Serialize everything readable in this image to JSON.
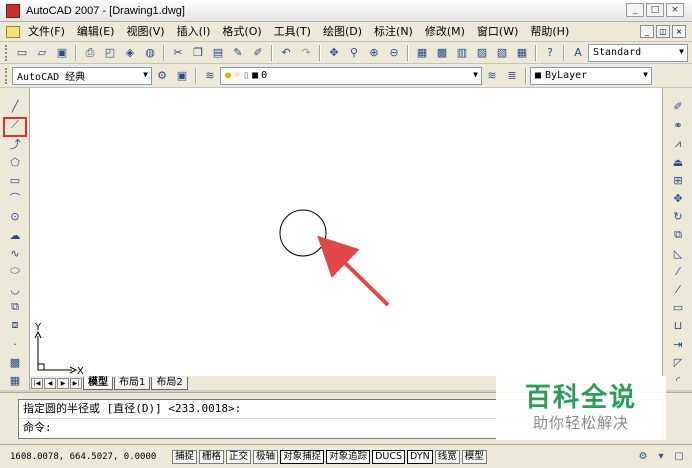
{
  "window": {
    "title": "AutoCAD 2007 - [Drawing1.dwg]",
    "controls": [
      "_",
      "□",
      "×"
    ],
    "mdi_controls": [
      "_",
      "◫",
      "×"
    ]
  },
  "menu": [
    "文件(F)",
    "编辑(E)",
    "视图(V)",
    "插入(I)",
    "格式(O)",
    "工具(T)",
    "绘图(D)",
    "标注(N)",
    "修改(M)",
    "窗口(W)",
    "帮助(H)"
  ],
  "toolbar_standard": {
    "text_style": "Standard"
  },
  "workspace": {
    "value": "AutoCAD 经典"
  },
  "layer": {
    "current": "0"
  },
  "color_control": {
    "value": "ByLayer"
  },
  "ucs": {
    "x_label": "X",
    "y_label": "Y"
  },
  "layout_tabs": {
    "nav_buttons": [
      "|◀",
      "◀",
      "▶",
      "▶|"
    ],
    "tabs": [
      "模型",
      "布局1",
      "布局2"
    ],
    "active": "模型"
  },
  "command": {
    "history": "指定圆的半径或 [直径(D)] <233.0018>:",
    "prompt": "命令:"
  },
  "status": {
    "coordinates": "1608.0078, 664.5027, 0.0000",
    "toggles": [
      {
        "label": "捕捉",
        "on": false
      },
      {
        "label": "栅格",
        "on": false
      },
      {
        "label": "正交",
        "on": false
      },
      {
        "label": "极轴",
        "on": false
      },
      {
        "label": "对象捕捉",
        "on": true
      },
      {
        "label": "对象追踪",
        "on": true
      },
      {
        "label": "DUCS",
        "on": true
      },
      {
        "label": "DYN",
        "on": true
      },
      {
        "label": "线宽",
        "on": false
      },
      {
        "label": "模型",
        "on": false
      }
    ]
  },
  "watermark": {
    "title": "百科全说",
    "subtitle": "助你轻松解决"
  },
  "annotation": {
    "arrow_color": "#e04848",
    "highlight_color": "#e03030"
  }
}
